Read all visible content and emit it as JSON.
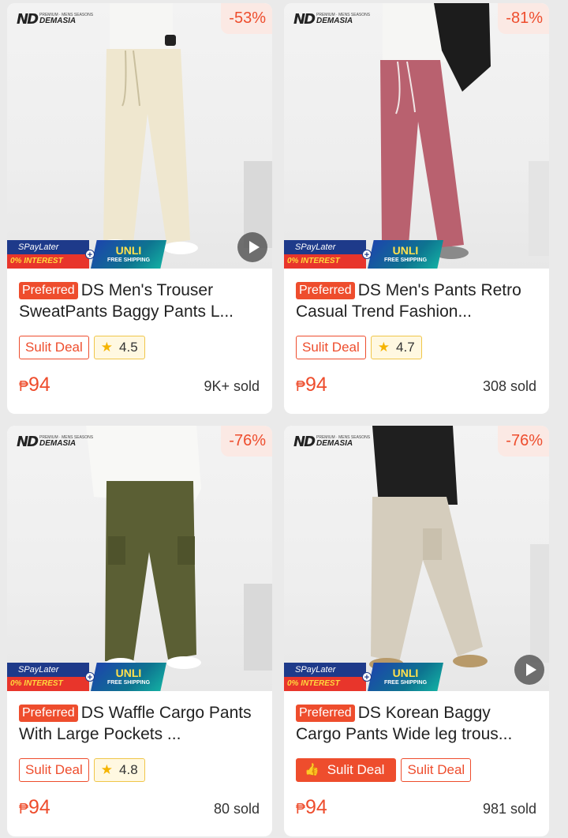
{
  "brand": {
    "mark": "ND",
    "sub": "PREMIUM · MENS SEASONS",
    "name": "DEMASIA"
  },
  "promo": {
    "spay_top": "SPayLater",
    "spay_bottom": "0% INTEREST",
    "unli_top": "UNLI",
    "unli_bottom": "FREE SHIPPING"
  },
  "preferred_label": "Preferred",
  "currency": "₱",
  "colors": {
    "accent": "#ee4d2d",
    "rating_bg": "#fff8e1",
    "star": "#f5b400"
  },
  "products": [
    {
      "discount": "-53%",
      "title": "DS Men's Trouser SweatPants Baggy Pants L...",
      "tag": "Sulit Deal",
      "rating": "4.5",
      "price": "94",
      "sold": "9K+ sold",
      "has_video": true,
      "pant_color": "#efe7cf"
    },
    {
      "discount": "-81%",
      "title": "DS Men's Pants Retro Casual Trend Fashion...",
      "tag": "Sulit Deal",
      "rating": "4.7",
      "price": "94",
      "sold": "308 sold",
      "has_video": false,
      "pant_color": "#b9616f"
    },
    {
      "discount": "-76%",
      "title": "DS Waffle Cargo Pants With Large Pockets ...",
      "tag": "Sulit Deal",
      "rating": "4.8",
      "price": "94",
      "sold": "80 sold",
      "has_video": false,
      "pant_color": "#5b5f34"
    },
    {
      "discount": "-76%",
      "title": "DS  Korean Baggy Cargo Pants Wide leg trous...",
      "tag": "Sulit Deal",
      "tag2": "Sulit Deal",
      "price": "94",
      "sold": "981 sold",
      "has_video": true,
      "pant_color": "#d5cdbd"
    }
  ]
}
